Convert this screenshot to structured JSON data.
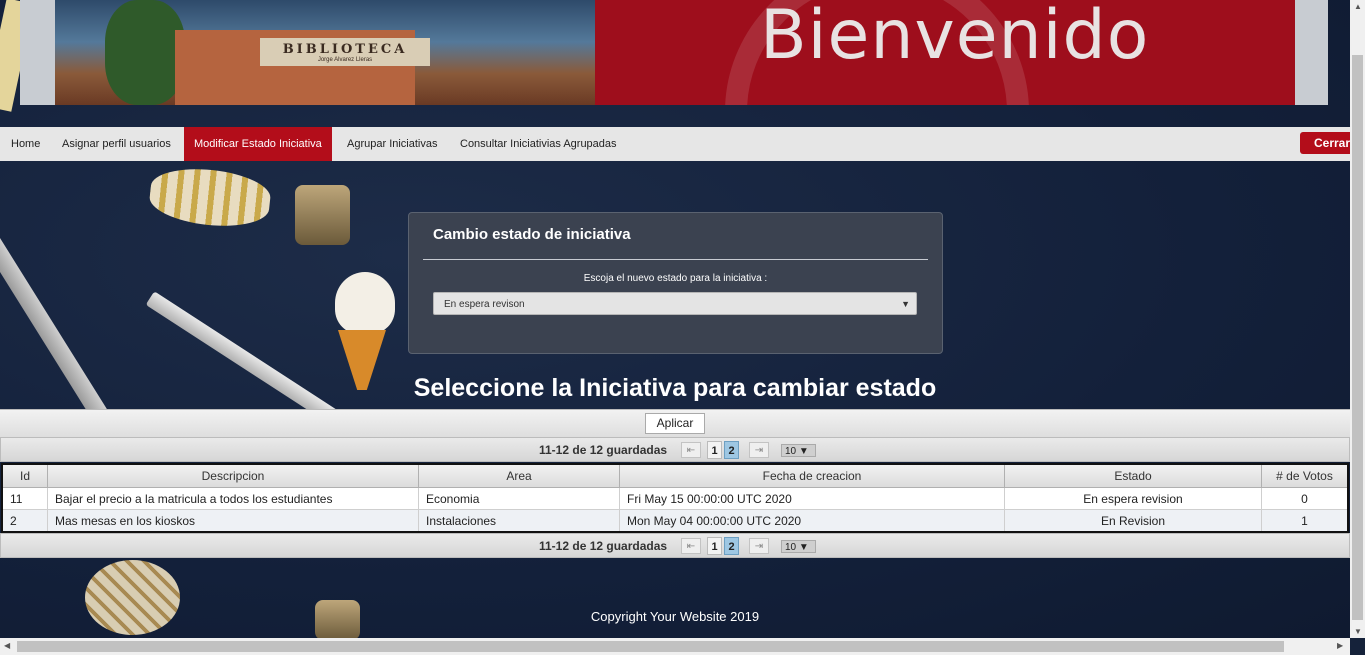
{
  "banner": {
    "title": "Bienvenido",
    "sign_main": "BIBLIOTECA",
    "sign_sub": "Jorge Alvarez Lleras"
  },
  "nav": {
    "items": [
      {
        "label": "Home"
      },
      {
        "label": "Asignar perfil usuarios"
      },
      {
        "label": "Modificar Estado Iniciativa"
      },
      {
        "label": "Agrupar Iniciativas"
      },
      {
        "label": "Consultar Iniciativias Agrupadas"
      }
    ],
    "active_index": 2,
    "logout_label": "Cerrar"
  },
  "panel": {
    "title": "Cambio estado de iniciativa",
    "label": "Escoja el nuevo estado para la iniciativa :",
    "selected_state": "En espera revison"
  },
  "heading": "Seleccione la Iniciativa para cambiar estado",
  "apply_label": "Aplicar",
  "pager": {
    "count_text": "11-12 de 12 guardadas",
    "first_icon": "first-page-icon",
    "prev_icon": "prev-page-icon",
    "pages": [
      "1",
      "2"
    ],
    "current_page": "2",
    "next_icon": "next-page-icon",
    "last_icon": "last-page-icon",
    "rows_per_page": "10"
  },
  "table": {
    "headers": [
      "Id",
      "Descripcion",
      "Area",
      "Fecha de creacion",
      "Estado",
      "# de Votos"
    ],
    "rows": [
      {
        "id": "11",
        "descripcion": "Bajar el precio a la matricula a todos los estudiantes",
        "area": "Economia",
        "fecha": "Fri May 15 00:00:00 UTC 2020",
        "estado": "En espera revision",
        "votos": "0"
      },
      {
        "id": "2",
        "descripcion": "Mas mesas en los kioskos",
        "area": "Instalaciones",
        "fecha": "Mon May 04 00:00:00 UTC 2020",
        "estado": "En Revision",
        "votos": "1"
      }
    ]
  },
  "footer": "Copyright Your Website 2019",
  "colors": {
    "accent_red": "#b30d1a",
    "banner_red": "#9e0e1c",
    "background": "#15223a",
    "panel": "#3b4250",
    "current_page": "#9ec7e3"
  }
}
